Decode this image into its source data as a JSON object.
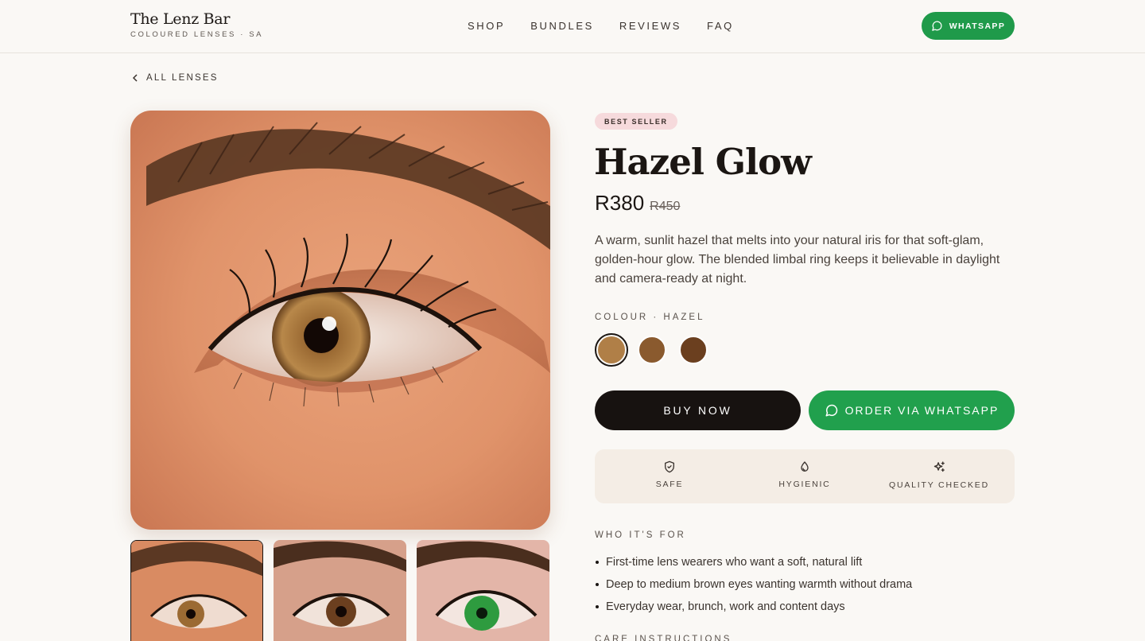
{
  "header": {
    "brand_title": "The Lenz Bar",
    "brand_sub": "COLOURED LENSES · SA",
    "nav": [
      "SHOP",
      "BUNDLES",
      "REVIEWS",
      "FAQ"
    ],
    "whatsapp_label": "WHATSAPP"
  },
  "back_label": "ALL LENSES",
  "product": {
    "badge": "BEST SELLER",
    "title": "Hazel Glow",
    "price": "R380",
    "price_was": "R450",
    "description": "A warm, sunlit hazel that melts into your natural iris for that soft-glam, golden-hour glow. The blended limbal ring keeps it believable in daylight and camera-ready at night.",
    "colour_label": "COLOUR · HAZEL",
    "swatches": [
      {
        "color": "#b07f47",
        "selected": true
      },
      {
        "color": "#8a5a2e",
        "selected": false
      },
      {
        "color": "#6b3f1f",
        "selected": false
      }
    ],
    "buy_label": "BUY NOW",
    "order_wa_label": "ORDER VIA WHATSAPP"
  },
  "features": [
    {
      "icon": "shield-check-icon",
      "label": "SAFE"
    },
    {
      "icon": "droplet-icon",
      "label": "HYGIENIC"
    },
    {
      "icon": "sparkles-icon",
      "label": "QUALITY CHECKED"
    }
  ],
  "who": {
    "label": "WHO IT'S FOR",
    "items": [
      "First-time lens wearers who want a soft, natural lift",
      "Deep to medium brown eyes wanting warmth without drama",
      "Everyday wear, brunch, work and content days"
    ]
  },
  "care_label": "CARE INSTRUCTIONS",
  "thumbnails": [
    {
      "iris": "hazel",
      "selected": true
    },
    {
      "iris": "brown",
      "selected": false
    },
    {
      "iris": "green",
      "selected": false
    }
  ],
  "colors": {
    "background": "#faf8f5",
    "whatsapp_green": "#21a04d",
    "buy_black": "#171210",
    "badge_pink": "#f6dadc",
    "features_bg": "#f4ede5"
  }
}
